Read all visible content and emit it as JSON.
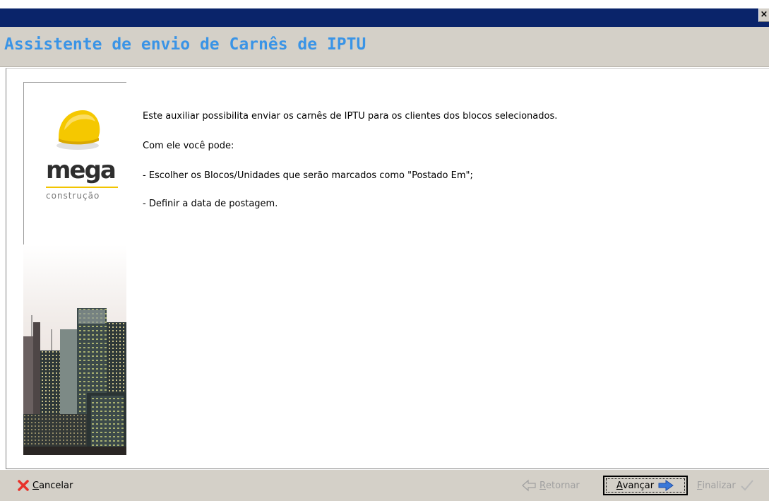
{
  "window": {
    "close_glyph": "×"
  },
  "header": {
    "title": "Assistente de envio de Carnês de IPTU"
  },
  "sidebar": {
    "logo_word": "mega",
    "logo_sub": "construção"
  },
  "content": {
    "intro": "Este auxiliar possibilita enviar os carnês de IPTU para os clientes dos blocos selecionados.",
    "subtitle": "Com ele você pode:",
    "items": [
      "-  Escolher os Blocos/Unidades que serão marcados como \"Postado Em\";",
      "-  Definir a data de postagem."
    ]
  },
  "footer": {
    "cancel": {
      "mnemonic": "C",
      "rest": "ancelar",
      "icon": "red-x-icon",
      "color": "#e8322a"
    },
    "back": {
      "mnemonic": "R",
      "rest": "etornar",
      "icon": "arrow-left-icon",
      "enabled": false
    },
    "next": {
      "mnemonic": "A",
      "rest": "vançar",
      "icon": "arrow-right-icon",
      "color": "#3a78d8",
      "enabled": true
    },
    "finish": {
      "mnemonic": "F",
      "rest": "inalizar",
      "icon": "check-icon",
      "enabled": false
    }
  },
  "colors": {
    "titlebar": "#0a246a",
    "header_bg": "#d4d0c8",
    "header_text": "#3a94e6",
    "helmet": "#f2c400"
  }
}
